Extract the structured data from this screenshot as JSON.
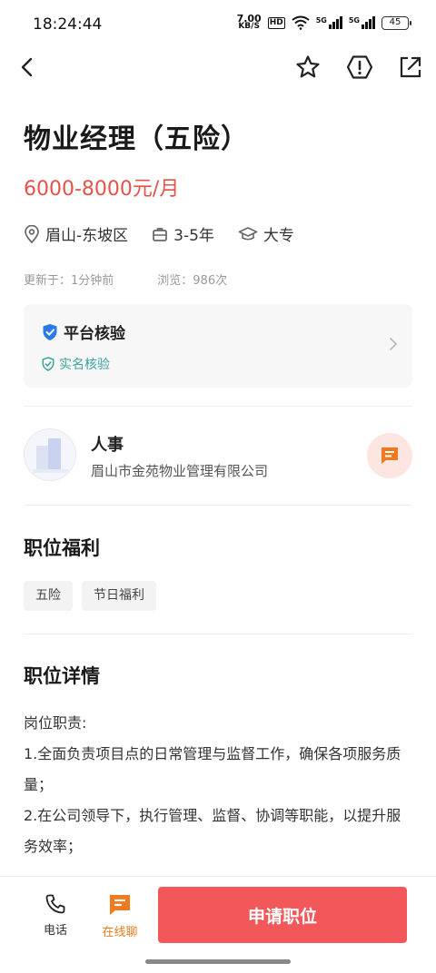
{
  "status_bar": {
    "time": "18:24:44",
    "net_speed_value": "7.00",
    "net_speed_unit": "KB/S",
    "hd": "HD",
    "signal1": "5G",
    "signal2": "5G",
    "battery": "45"
  },
  "nav": {
    "icons": [
      "back-icon",
      "star-icon",
      "report-icon",
      "share-icon"
    ]
  },
  "job": {
    "title": "物业经理（五险）",
    "salary": "6000-8000元/月",
    "location": "眉山-东坡区",
    "experience": "3-5年",
    "education": "大专",
    "updated": "更新于：1分钟前",
    "views": "浏览：986次"
  },
  "verification": {
    "title": "平台核验",
    "sub": "实名核验"
  },
  "company": {
    "contact": "人事",
    "name": "眉山市金苑物业管理有限公司"
  },
  "benefits": {
    "title": "职位福利",
    "tags": [
      "五险",
      "节日福利"
    ]
  },
  "details": {
    "title": "职位详情",
    "lines": [
      "岗位职责:",
      "1.全面负责项目点的日常管理与监督工作，确保各项服务质量；",
      "2.在公司领导下，执行管理、监督、协调等职能，以提升服务效率；"
    ]
  },
  "bottom": {
    "phone_label": "电话",
    "chat_label": "在线聊",
    "apply_label": "申请职位"
  },
  "colors": {
    "salary": "#e2534a",
    "apply_button": "#f2575a",
    "active_tab": "#f07b1e",
    "verify_green": "#3aa59a"
  }
}
